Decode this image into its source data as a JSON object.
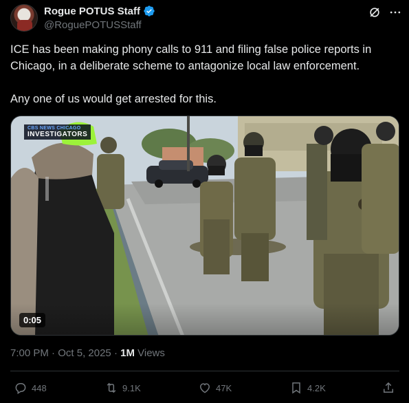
{
  "author": {
    "display_name": "Rogue POTUS Staff",
    "handle": "@RoguePOTUSStaff",
    "verified": true
  },
  "icons": {
    "verified": "verified-badge-icon",
    "grok": "grok-icon",
    "more": "more-icon",
    "reply": "reply-icon",
    "retweet": "retweet-icon",
    "like": "like-icon",
    "bookmark": "bookmark-icon",
    "share": "share-icon"
  },
  "tweet": {
    "paragraphs": [
      "ICE has been making phony calls to 911 and filing false police reports in Chicago, in a deliberate scheme to antagonize local law enforcement.",
      "Any one of us would get arrested for this."
    ]
  },
  "media": {
    "channel_line1_a": "CBS NEWS",
    "channel_line1_b": " CHICAGO",
    "channel_line2": "INVESTIGATORS",
    "duration": "0:05"
  },
  "meta": {
    "time": "7:00 PM",
    "separator": " · ",
    "date": "Oct 5, 2025",
    "views_count": "1M",
    "views_label": " Views"
  },
  "actions": {
    "replies": "448",
    "reposts": "9.1K",
    "likes": "47K",
    "bookmarks": "4.2K"
  },
  "colors": {
    "background": "#000000",
    "text": "#e7e9ea",
    "muted": "#71767b",
    "verified": "#1d9bf0",
    "divider": "#2f3336"
  }
}
